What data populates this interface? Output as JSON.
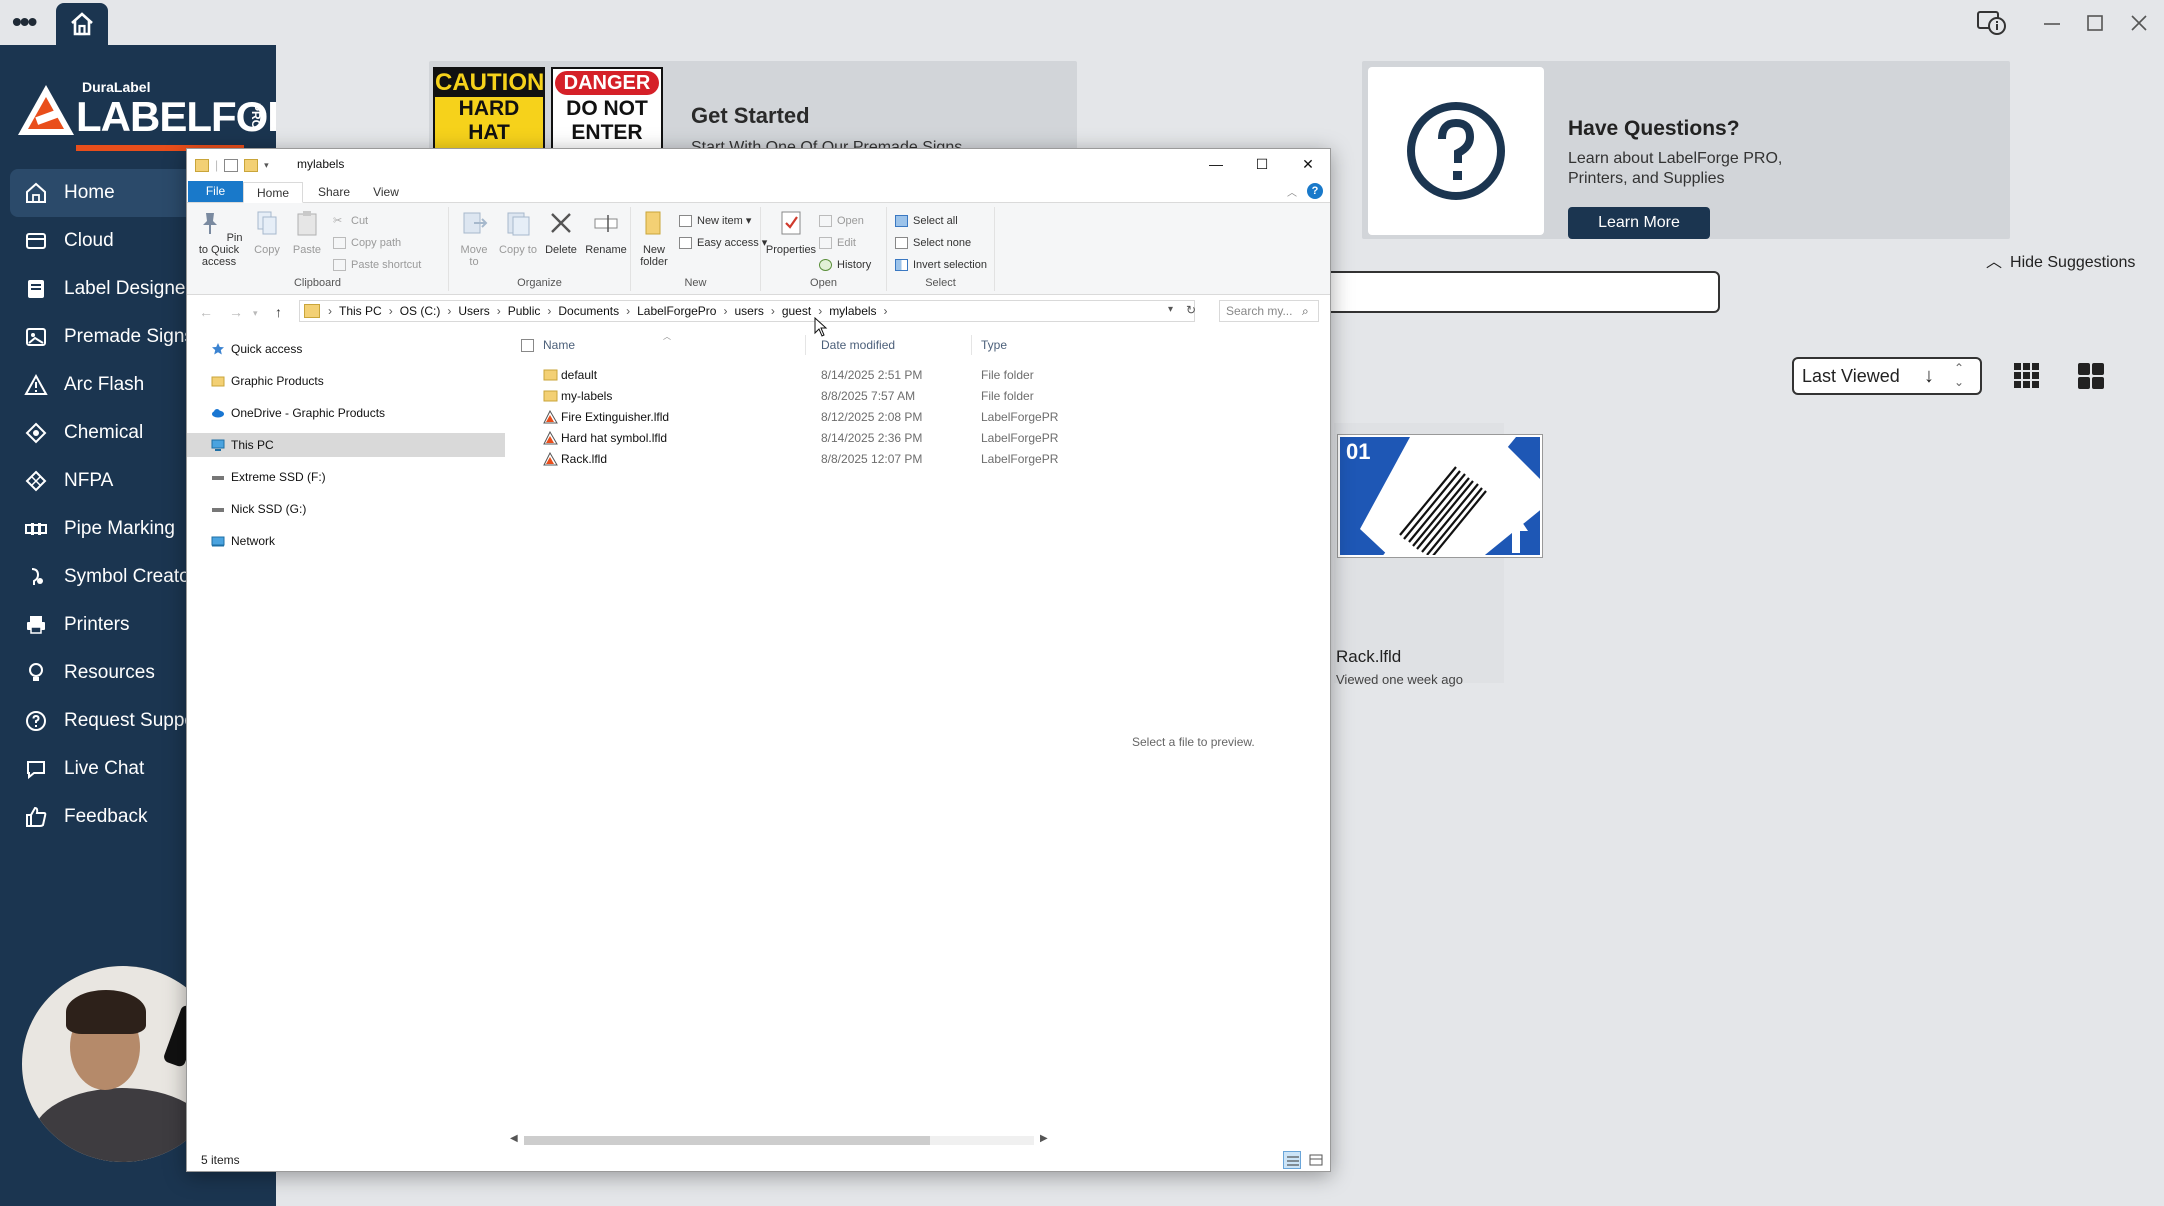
{
  "app": {
    "brand_small": "DuraLabel",
    "brand_name": "LABELFORGE",
    "brand_pro": "PRO"
  },
  "sidebar": {
    "items": [
      {
        "label": "Home",
        "icon": "home-icon",
        "active": true
      },
      {
        "label": "Cloud",
        "icon": "cloud-icon"
      },
      {
        "label": "Label Designer",
        "icon": "label-icon"
      },
      {
        "label": "Premade Signs",
        "icon": "image-icon"
      },
      {
        "label": "Arc Flash",
        "icon": "warning-icon"
      },
      {
        "label": "Chemical",
        "icon": "chemical-icon"
      },
      {
        "label": "NFPA",
        "icon": "diamond-icon"
      },
      {
        "label": "Pipe Marking",
        "icon": "pipe-icon"
      },
      {
        "label": "Symbol Creator",
        "icon": "symbol-icon"
      },
      {
        "label": "Printers",
        "icon": "printer-icon"
      },
      {
        "label": "Resources",
        "icon": "lightbulb-icon"
      },
      {
        "label": "Request Support",
        "icon": "help-icon"
      },
      {
        "label": "Live Chat",
        "icon": "chat-icon"
      },
      {
        "label": "Feedback",
        "icon": "thumbs-up-icon"
      }
    ]
  },
  "get_started": {
    "title": "Get Started",
    "subtitle": "Start With One Of Our Premade Signs",
    "sign1_head": "CAUTION",
    "sign1_body": "HARD HAT REQUIRED",
    "sign2_head": "DANGER",
    "sign2_body": "DO NOT ENTER"
  },
  "questions": {
    "title": "Have Questions?",
    "text": "Learn about LabelForge PRO, Printers, and Supplies",
    "button": "Learn More"
  },
  "hide_suggestions": "Hide Suggestions",
  "sort": {
    "label": "Last Viewed"
  },
  "recent": {
    "thumb_number": "01",
    "name": "Rack.lfld",
    "meta": "Viewed one week ago"
  },
  "explorer": {
    "title": "mylabels",
    "tabs": [
      "File",
      "Home",
      "Share",
      "View"
    ],
    "ribbon": {
      "clipboard": {
        "label": "Clipboard",
        "pin": "Pin to Quick access",
        "copy": "Copy",
        "paste": "Paste",
        "cut": "Cut",
        "copy_path": "Copy path",
        "paste_shortcut": "Paste shortcut"
      },
      "organize": {
        "label": "Organize",
        "move_to": "Move to",
        "copy_to": "Copy to",
        "delete": "Delete",
        "rename": "Rename"
      },
      "new": {
        "label": "New",
        "new_folder": "New folder",
        "new_item": "New item",
        "easy_access": "Easy access"
      },
      "open": {
        "label": "Open",
        "properties": "Properties",
        "open": "Open",
        "edit": "Edit",
        "history": "History"
      },
      "select": {
        "label": "Select",
        "select_all": "Select all",
        "select_none": "Select none",
        "invert": "Invert selection"
      }
    },
    "breadcrumbs": [
      "This PC",
      "OS (C:)",
      "Users",
      "Public",
      "Documents",
      "LabelForgePro",
      "users",
      "guest",
      "mylabels"
    ],
    "search_placeholder": "Search my...",
    "nav_pane": [
      {
        "label": "Quick access",
        "icon": "star-icon"
      },
      {
        "label": "Graphic Products",
        "icon": "folder-icon"
      },
      {
        "label": "OneDrive - Graphic Products",
        "icon": "cloud-icon"
      },
      {
        "label": "This PC",
        "icon": "computer-icon",
        "selected": true
      },
      {
        "label": "Extreme SSD (F:)",
        "icon": "drive-icon"
      },
      {
        "label": "Nick SSD (G:)",
        "icon": "drive-icon"
      },
      {
        "label": "Network",
        "icon": "network-icon"
      }
    ],
    "columns": {
      "name": "Name",
      "date": "Date modified",
      "type": "Type"
    },
    "files": [
      {
        "name": "default",
        "date": "8/14/2025 2:51 PM",
        "type": "File folder",
        "kind": "folder"
      },
      {
        "name": "my-labels",
        "date": "8/8/2025 7:57 AM",
        "type": "File folder",
        "kind": "folder"
      },
      {
        "name": "Fire Extinguisher.lfld",
        "date": "8/12/2025 2:08 PM",
        "type": "LabelForgePR",
        "kind": "lfld"
      },
      {
        "name": "Hard hat symbol.lfld",
        "date": "8/14/2025 2:36 PM",
        "type": "LabelForgePR",
        "kind": "lfld"
      },
      {
        "name": "Rack.lfld",
        "date": "8/8/2025 12:07 PM",
        "type": "LabelForgePR",
        "kind": "lfld"
      }
    ],
    "preview_text": "Select a file to preview.",
    "status": "5 items"
  },
  "colors": {
    "sidebar_bg": "#1b3550",
    "accent_orange": "#e94e1b",
    "explorer_file_tab": "#1979ca"
  }
}
